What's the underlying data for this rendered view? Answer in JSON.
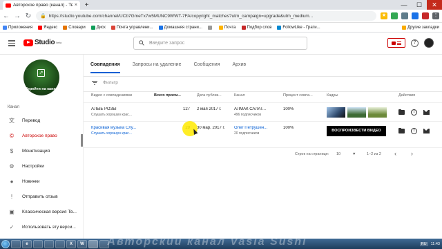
{
  "browser": {
    "tab_title": "Авторское право (канал) - Твор",
    "tab_close": "×",
    "new_tab": "+",
    "url": "https://studio.youtube.com/channel/UCb7GmeTx7w5MUNC9WWT-7FA/copyright_matches?utm_campaign=upgrade&utm_medium...",
    "back": "←",
    "forward": "→",
    "reload": "↻",
    "window_controls": [
      "—",
      "☐",
      "✕"
    ]
  },
  "bookmarks": [
    {
      "label": "Приложения",
      "color": "#4285f4"
    },
    {
      "label": "Яндекс",
      "color": "#ff0000"
    },
    {
      "label": "Словари",
      "color": "#e37400"
    },
    {
      "label": "Диск",
      "color": "#0f9d58"
    },
    {
      "label": "Почта управлени...",
      "color": "#db4437"
    },
    {
      "label": "Домашняя страни...",
      "color": "#1a73e8"
    },
    {
      "label": "",
      "color": "#999999"
    },
    {
      "label": "Почта",
      "color": "#ffb300"
    },
    {
      "label": "Подбор слов",
      "color": "#c62828"
    },
    {
      "label": "FollowLike - Грати...",
      "color": "#0288d1"
    }
  ],
  "bookmarks_other": "Другие закладки",
  "header": {
    "logo_text": "Studio",
    "logo_badge": "beta",
    "search_placeholder": "Введите запрос",
    "help": "?"
  },
  "sidebar": {
    "go_to_channel": "Перейти на канал",
    "section_label": "Канал",
    "items": [
      {
        "label": "Перевод",
        "icon": "translate-icon",
        "glyph": "文",
        "active": false
      },
      {
        "label": "Авторское право",
        "icon": "copyright-icon",
        "glyph": "©",
        "active": true
      },
      {
        "label": "Монетизация",
        "icon": "dollar-icon",
        "glyph": "$",
        "active": false
      },
      {
        "label": "Настройки",
        "icon": "gear-icon",
        "glyph": "⚙",
        "active": false
      },
      {
        "label": "Новинки",
        "icon": "news-icon",
        "glyph": "●",
        "active": false
      },
      {
        "label": "Отправить отзыв",
        "icon": "feedback-icon",
        "glyph": "!",
        "active": false
      },
      {
        "label": "Классическая версия Тв...",
        "icon": "classic-icon",
        "glyph": "▣",
        "active": false
      },
      {
        "label": "Использовать эту верси...",
        "icon": "check-icon",
        "glyph": "✓",
        "active": false
      }
    ]
  },
  "tabs": [
    "Совпадения",
    "Запросы на удаление",
    "Сообщения",
    "Архив"
  ],
  "filter_placeholder": "Фильтр",
  "table": {
    "headers": [
      "Видео с совпадениями",
      "Всего просм...",
      "Дата публик...",
      "Канал",
      "Процент совпа...",
      "Кадры",
      "Действия"
    ],
    "rows": [
      {
        "title": "АЛЫЕ РОЗЫ",
        "subtitle": "",
        "views": "127",
        "date": "2 мая 2017 г.",
        "channel": "АЛМАК САЛАТ...",
        "subs": "496 подписчиков",
        "percent": "100%",
        "frames": [
          "#2f4a6e",
          "#3d6b34",
          "#6c8a3a"
        ],
        "play_label": ""
      },
      {
        "title": "Красивая музыка Слу...",
        "subtitle": "Слушать хорошую крас...",
        "views": "29",
        "date": "30 мар. 2017 г.",
        "channel": "Олег Петрушен...",
        "subs": "20 подписчиков",
        "percent": "100%",
        "frames": [],
        "play_label": "ВОСПРОИЗВЕСТИ ВИДЕО"
      }
    ],
    "row1_subtitle": "Слушать хорошую крас..."
  },
  "pager": {
    "rows_label": "Строк на странице:",
    "rows_value": "10",
    "range": "1–2 из 2",
    "prev": "‹",
    "next": "›"
  },
  "taskbar": {
    "watermark": "Авторский канал Vasia Sushi",
    "lang": "RU",
    "time": "11:43",
    "apps": [
      "",
      "e",
      "",
      "",
      "",
      "X",
      "W",
      "",
      ""
    ]
  }
}
